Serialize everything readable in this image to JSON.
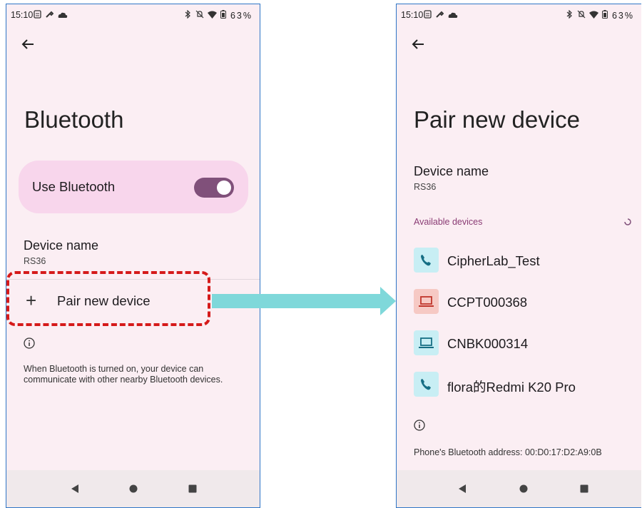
{
  "left_screen": {
    "status_bar": {
      "time": "15:10",
      "battery": "63%"
    },
    "page_title": "Bluetooth",
    "use_bluetooth": {
      "label": "Use Bluetooth",
      "enabled": true
    },
    "device_name": {
      "title": "Device name",
      "value": "RS36"
    },
    "pair_new_device_label": "Pair new device",
    "footer_text": "When Bluetooth is turned on, your device can communicate with other nearby Bluetooth devices."
  },
  "right_screen": {
    "status_bar": {
      "time": "15:10",
      "battery": "63%"
    },
    "page_title": "Pair new device",
    "device_name": {
      "title": "Device name",
      "value": "RS36"
    },
    "available_devices_header": "Available devices",
    "devices": [
      {
        "name": "CipherLab_Test",
        "icon": "phone-icon",
        "icon_bg": "#c8eef4",
        "icon_color": "#166e84"
      },
      {
        "name": "CCPT000368",
        "icon": "laptop-icon",
        "icon_bg": "#f6c9c4",
        "icon_color": "#c0352b"
      },
      {
        "name": "CNBK000314",
        "icon": "laptop-icon",
        "icon_bg": "#c8eef4",
        "icon_color": "#166e84"
      },
      {
        "name": "flora的Redmi K20 Pro",
        "icon": "phone-icon",
        "icon_bg": "#c8eef4",
        "icon_color": "#166e84"
      }
    ],
    "bluetooth_address_text": "Phone's Bluetooth address: 00:D0:17:D2:A9:0B"
  },
  "colors": {
    "background": "#fbeef3",
    "accent": "#80507a",
    "toggle_card": "#f8d6ec",
    "highlight_border": "#d51a1a",
    "arrow": "#7fd8da",
    "phone_border": "#2e75c6"
  }
}
